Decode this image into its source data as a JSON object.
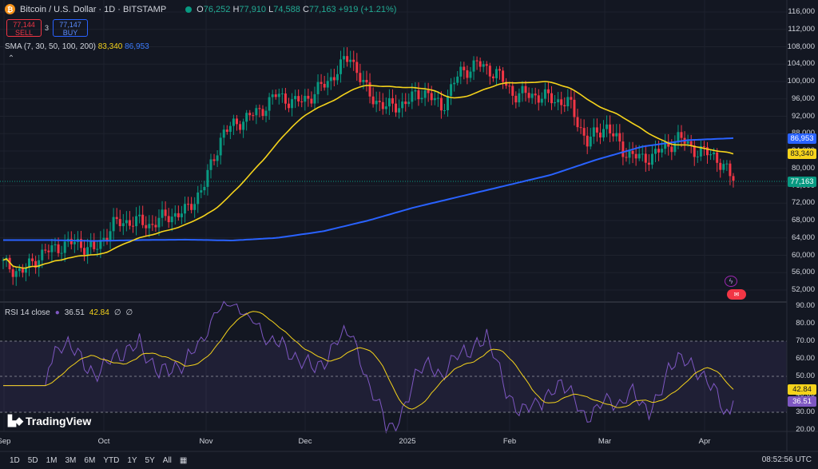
{
  "header": {
    "symbol_icon": "bitcoin-icon",
    "title": "Bitcoin / U.S. Dollar · 1D · BITSTAMP",
    "open_label": "O",
    "open": "76,252",
    "high_label": "H",
    "high": "77,910",
    "low_label": "L",
    "low": "74,588",
    "close_label": "C",
    "close": "77,163",
    "change": "+919 (+1.21%)"
  },
  "trade": {
    "sell_price": "77,144",
    "sell_label": "SELL",
    "spread": "3",
    "buy_price": "77,147",
    "buy_label": "BUY"
  },
  "sma_legend": {
    "label": "SMA (7, 30, 50, 100, 200)",
    "value_yellow": "83,340",
    "value_blue": "86,953"
  },
  "rsi_legend": {
    "label": "RSI 14 close",
    "value_purple": "36.51",
    "value_yellow": "42.84",
    "extra1": "∅",
    "extra2": "∅"
  },
  "price_axis": [
    "116,000",
    "112,000",
    "108,000",
    "104,000",
    "100,000",
    "96,000",
    "92,000",
    "88,000",
    "84,000",
    "80,000",
    "76,000",
    "72,000",
    "68,000",
    "64,000",
    "60,000",
    "56,000",
    "52,000"
  ],
  "price_tags": {
    "sma_blue": "86,953",
    "sma_yellow": "83,340",
    "last_price": "77,163"
  },
  "rsi_axis": [
    "90.00",
    "80.00",
    "70.00",
    "60.00",
    "50.00",
    "40.00",
    "30.00",
    "20.00"
  ],
  "rsi_tags": {
    "signal": "42.84",
    "rsi": "36.51"
  },
  "time_axis": [
    "Sep",
    "Oct",
    "Nov",
    "Dec",
    "2025",
    "Feb",
    "Mar",
    "Apr"
  ],
  "brand": "TradingView",
  "timeframes": [
    "1D",
    "5D",
    "1M",
    "3M",
    "6M",
    "YTD",
    "1Y",
    "5Y",
    "All"
  ],
  "clock": "08:52:56 UTC",
  "colors": {
    "up": "#089981",
    "down": "#f23645",
    "sma_yellow": "#f5d31b",
    "sma_blue": "#2962ff",
    "rsi": "#7e57c2",
    "background": "#131722"
  },
  "chart_data": [
    {
      "type": "candlestick",
      "series": [
        {
          "name": "BTC/USD",
          "approx_close_path": [
            [
              "Sep",
              58000
            ],
            [
              "Sep",
              56000
            ],
            [
              "Sep",
              60000
            ],
            [
              "Sep",
              62000
            ],
            [
              "Oct",
              63000
            ],
            [
              "Oct",
              61000
            ],
            [
              "Oct",
              67000
            ],
            [
              "Oct",
              68000
            ],
            [
              "Oct",
              67000
            ],
            [
              "Oct",
              69000
            ],
            [
              "Nov",
              70000
            ],
            [
              "Nov",
              76000
            ],
            [
              "Nov",
              88000
            ],
            [
              "Nov",
              91000
            ],
            [
              "Nov",
              93000
            ],
            [
              "Nov",
              97000
            ],
            [
              "Dec",
              95000
            ],
            [
              "Dec",
              97000
            ],
            [
              "Dec",
              101000
            ],
            [
              "Dec",
              106000
            ],
            [
              "Dec",
              97000
            ],
            [
              "Dec",
              94000
            ],
            [
              "2025",
              95000
            ],
            [
              "2025",
              98000
            ],
            [
              "2025",
              94000
            ],
            [
              "2025",
              102000
            ],
            [
              "2025",
              104000
            ],
            [
              "2025",
              102000
            ],
            [
              "Feb",
              97000
            ],
            [
              "Feb",
              97000
            ],
            [
              "Feb",
              96000
            ],
            [
              "Feb",
              95000
            ],
            [
              "Mar",
              86000
            ],
            [
              "Mar",
              90000
            ],
            [
              "Mar",
              84000
            ],
            [
              "Mar",
              82000
            ],
            [
              "Mar",
              84000
            ],
            [
              "Mar",
              87000
            ],
            [
              "Mar",
              84000
            ],
            [
              "Apr",
              83000
            ],
            [
              "Apr",
              77163
            ]
          ]
        },
        {
          "name": "SMA",
          "last": 83340
        },
        {
          "name": "SMA",
          "last": 86953
        }
      ],
      "ylim": [
        50000,
        118000
      ]
    },
    {
      "type": "line",
      "title": "RSI 14 close",
      "series": [
        {
          "name": "RSI",
          "last": 36.51
        },
        {
          "name": "RSI-based MA",
          "last": 42.84
        }
      ],
      "bands": [
        30,
        50,
        70
      ],
      "ylim": [
        20,
        90
      ]
    }
  ]
}
